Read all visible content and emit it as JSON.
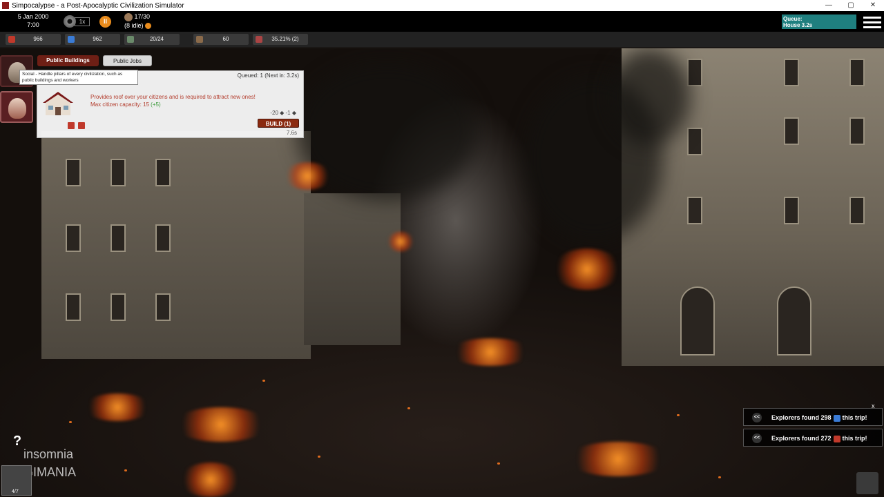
{
  "window": {
    "title": "Simpocalypse - a Post-Apocalyptic Civilization Simulator",
    "minimize": "—",
    "maximize": "▢",
    "close": "✕"
  },
  "hud": {
    "date": "5 Jan 2000",
    "time": "7:00",
    "speed": "1x",
    "pause": "II",
    "population": "17/30",
    "idle": "(8 idle)",
    "queue_label": "Queue:",
    "queue_item": "House 3.2s"
  },
  "resources": [
    {
      "name": "food",
      "value": "966",
      "color": "#c0392b"
    },
    {
      "name": "water",
      "value": "962",
      "color": "#3a7bd5"
    },
    {
      "name": "materials",
      "value": "20/24",
      "color": "#6a8a6a"
    },
    {
      "name": "wood",
      "value": "60",
      "color": "#8a6a4a"
    },
    {
      "name": "research",
      "value": "35.21% (2)",
      "color": "#aa4444"
    }
  ],
  "panel": {
    "tab_public_buildings": "Public Buildings",
    "tab_public_jobs": "Public Jobs",
    "tooltip": "Social - Handle pillars of every civilization, such as public buildings and workers",
    "queued": "Queued: 1 (Next in: 3.2s)",
    "desc_line1": "Provides roof over your citizens and is required to attract new ones!",
    "desc_line2": "Max citizen capacity: 15",
    "desc_bonus": "(+5)",
    "cost_a": "-20",
    "cost_b": "-1",
    "build": "BUILD (1)",
    "build_time": "7.6s"
  },
  "bottom_left": {
    "help": "?",
    "watermark_line1": "insomnia",
    "watermark_line2": "GIMANIA",
    "count": "4/7"
  },
  "notifications": {
    "close": "x",
    "items": [
      {
        "chevron": "<<",
        "prefix": "Explorers found 298",
        "suffix": "this trip!",
        "icon_color": "#3a7bd5"
      },
      {
        "chevron": "<<",
        "prefix": "Explorers found 272",
        "suffix": "this trip!",
        "icon_color": "#c0392b"
      }
    ]
  }
}
